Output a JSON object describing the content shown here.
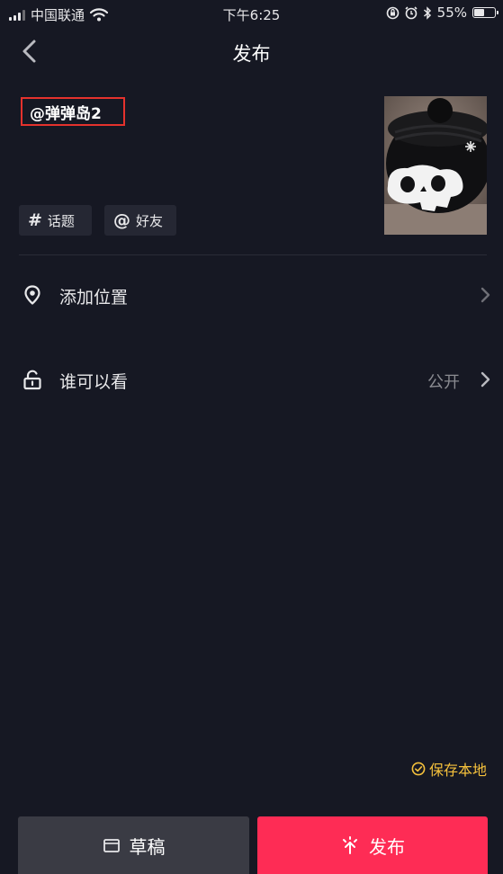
{
  "status_bar": {
    "carrier": "中国联通",
    "time": "下午6:25",
    "battery_percent": "55%",
    "battery_level": 0.55
  },
  "nav": {
    "title": "发布"
  },
  "caption": {
    "mention_text": "@弹弹岛2"
  },
  "tags": [
    {
      "symbol": "#",
      "label": "话题"
    },
    {
      "symbol": "@",
      "label": "好友"
    }
  ],
  "options": {
    "location": {
      "label": "添加位置"
    },
    "visibility": {
      "label": "谁可以看",
      "value": "公开"
    }
  },
  "save_local": {
    "label": "保存本地"
  },
  "buttons": {
    "draft_label": "草稿",
    "publish_label": "发布"
  },
  "colors": {
    "background": "#161823",
    "publish": "#fe2c55",
    "draft": "#3a3b44",
    "save_local": "#f5c13c",
    "highlight_box": "#e5322d"
  }
}
